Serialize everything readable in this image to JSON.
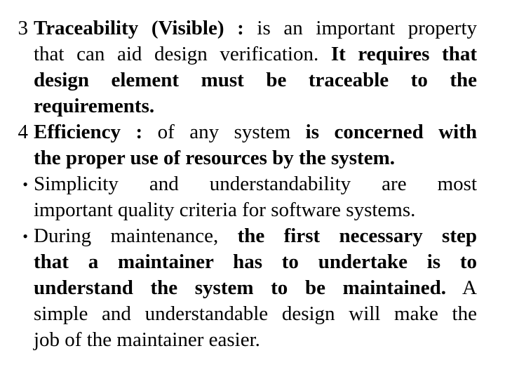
{
  "slide": {
    "background_color": "#ffffff",
    "text_color": "#000000",
    "items": [
      {
        "marker": "3",
        "marker_type": "number",
        "lines": [
          [
            {
              "text": "Traceability (Visible) :",
              "bold": true
            },
            {
              "text": " is an important property",
              "bold": false
            }
          ],
          [
            {
              "text": "that can aid design verification.",
              "bold": false
            },
            {
              "text": " It requires that",
              "bold": true
            }
          ],
          [
            {
              "text": "design element must be traceable to the",
              "bold": true
            }
          ],
          [
            {
              "text": "requirements.",
              "bold": true
            }
          ]
        ]
      },
      {
        "marker": "4",
        "marker_type": "number",
        "lines": [
          [
            {
              "text": "Efficiency :",
              "bold": true
            },
            {
              "text": " of any system ",
              "bold": false
            },
            {
              "text": "is concerned with",
              "bold": true
            }
          ],
          [
            {
              "text": "the proper use of resources by the system.",
              "bold": true
            }
          ]
        ]
      },
      {
        "marker": "•",
        "marker_type": "bullet",
        "lines": [
          [
            {
              "text": "Simplicity and understandability are most",
              "bold": false
            }
          ],
          [
            {
              "text": "important quality criteria for software systems.",
              "bold": false
            }
          ]
        ]
      },
      {
        "marker": "•",
        "marker_type": "bullet",
        "lines": [
          [
            {
              "text": "During maintenance,",
              "bold": false
            },
            {
              "text": " the first necessary step",
              "bold": true
            }
          ],
          [
            {
              "text": "that a maintainer has to undertake is to",
              "bold": true
            }
          ],
          [
            {
              "text": "understand the system to be maintained.",
              "bold": true
            },
            {
              "text": " A",
              "bold": false
            }
          ],
          [
            {
              "text": "simple and understandable design will make the",
              "bold": false
            }
          ],
          [
            {
              "text": "job of the maintainer easier.",
              "bold": false
            }
          ]
        ]
      }
    ]
  }
}
